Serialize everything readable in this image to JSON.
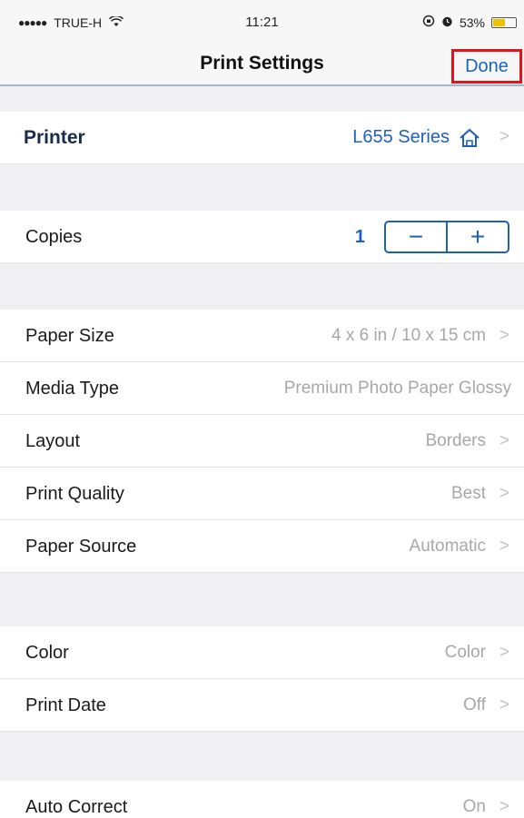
{
  "status_bar": {
    "signal": "●●●●●",
    "carrier": "TRUE-H",
    "time": "11:21",
    "battery_text": "53%",
    "battery_level": 0.53,
    "battery_color": "#f2c200"
  },
  "nav": {
    "title": "Print Settings",
    "done_label": "Done"
  },
  "printer": {
    "label": "Printer",
    "value": "L655 Series",
    "icon": "home-icon"
  },
  "copies": {
    "label": "Copies",
    "value": "1",
    "minus": "−",
    "plus": "+"
  },
  "paper": {
    "paper_size_label": "Paper Size",
    "paper_size_value": "4 x 6 in / 10 x 15 cm",
    "media_type_label": "Media Type",
    "media_type_value": "Premium Photo Paper Glossy",
    "layout_label": "Layout",
    "layout_value": "Borders",
    "quality_label": "Print Quality",
    "quality_value": "Best",
    "source_label": "Paper Source",
    "source_value": "Automatic"
  },
  "color": {
    "color_label": "Color",
    "color_value": "Color",
    "date_label": "Print Date",
    "date_value": "Off"
  },
  "correct": {
    "label": "Auto Correct",
    "value": "On"
  },
  "colors": {
    "accent": "#1f5fbf",
    "highlight_border": "#e0141b",
    "value_gray": "#a8a8ac"
  }
}
